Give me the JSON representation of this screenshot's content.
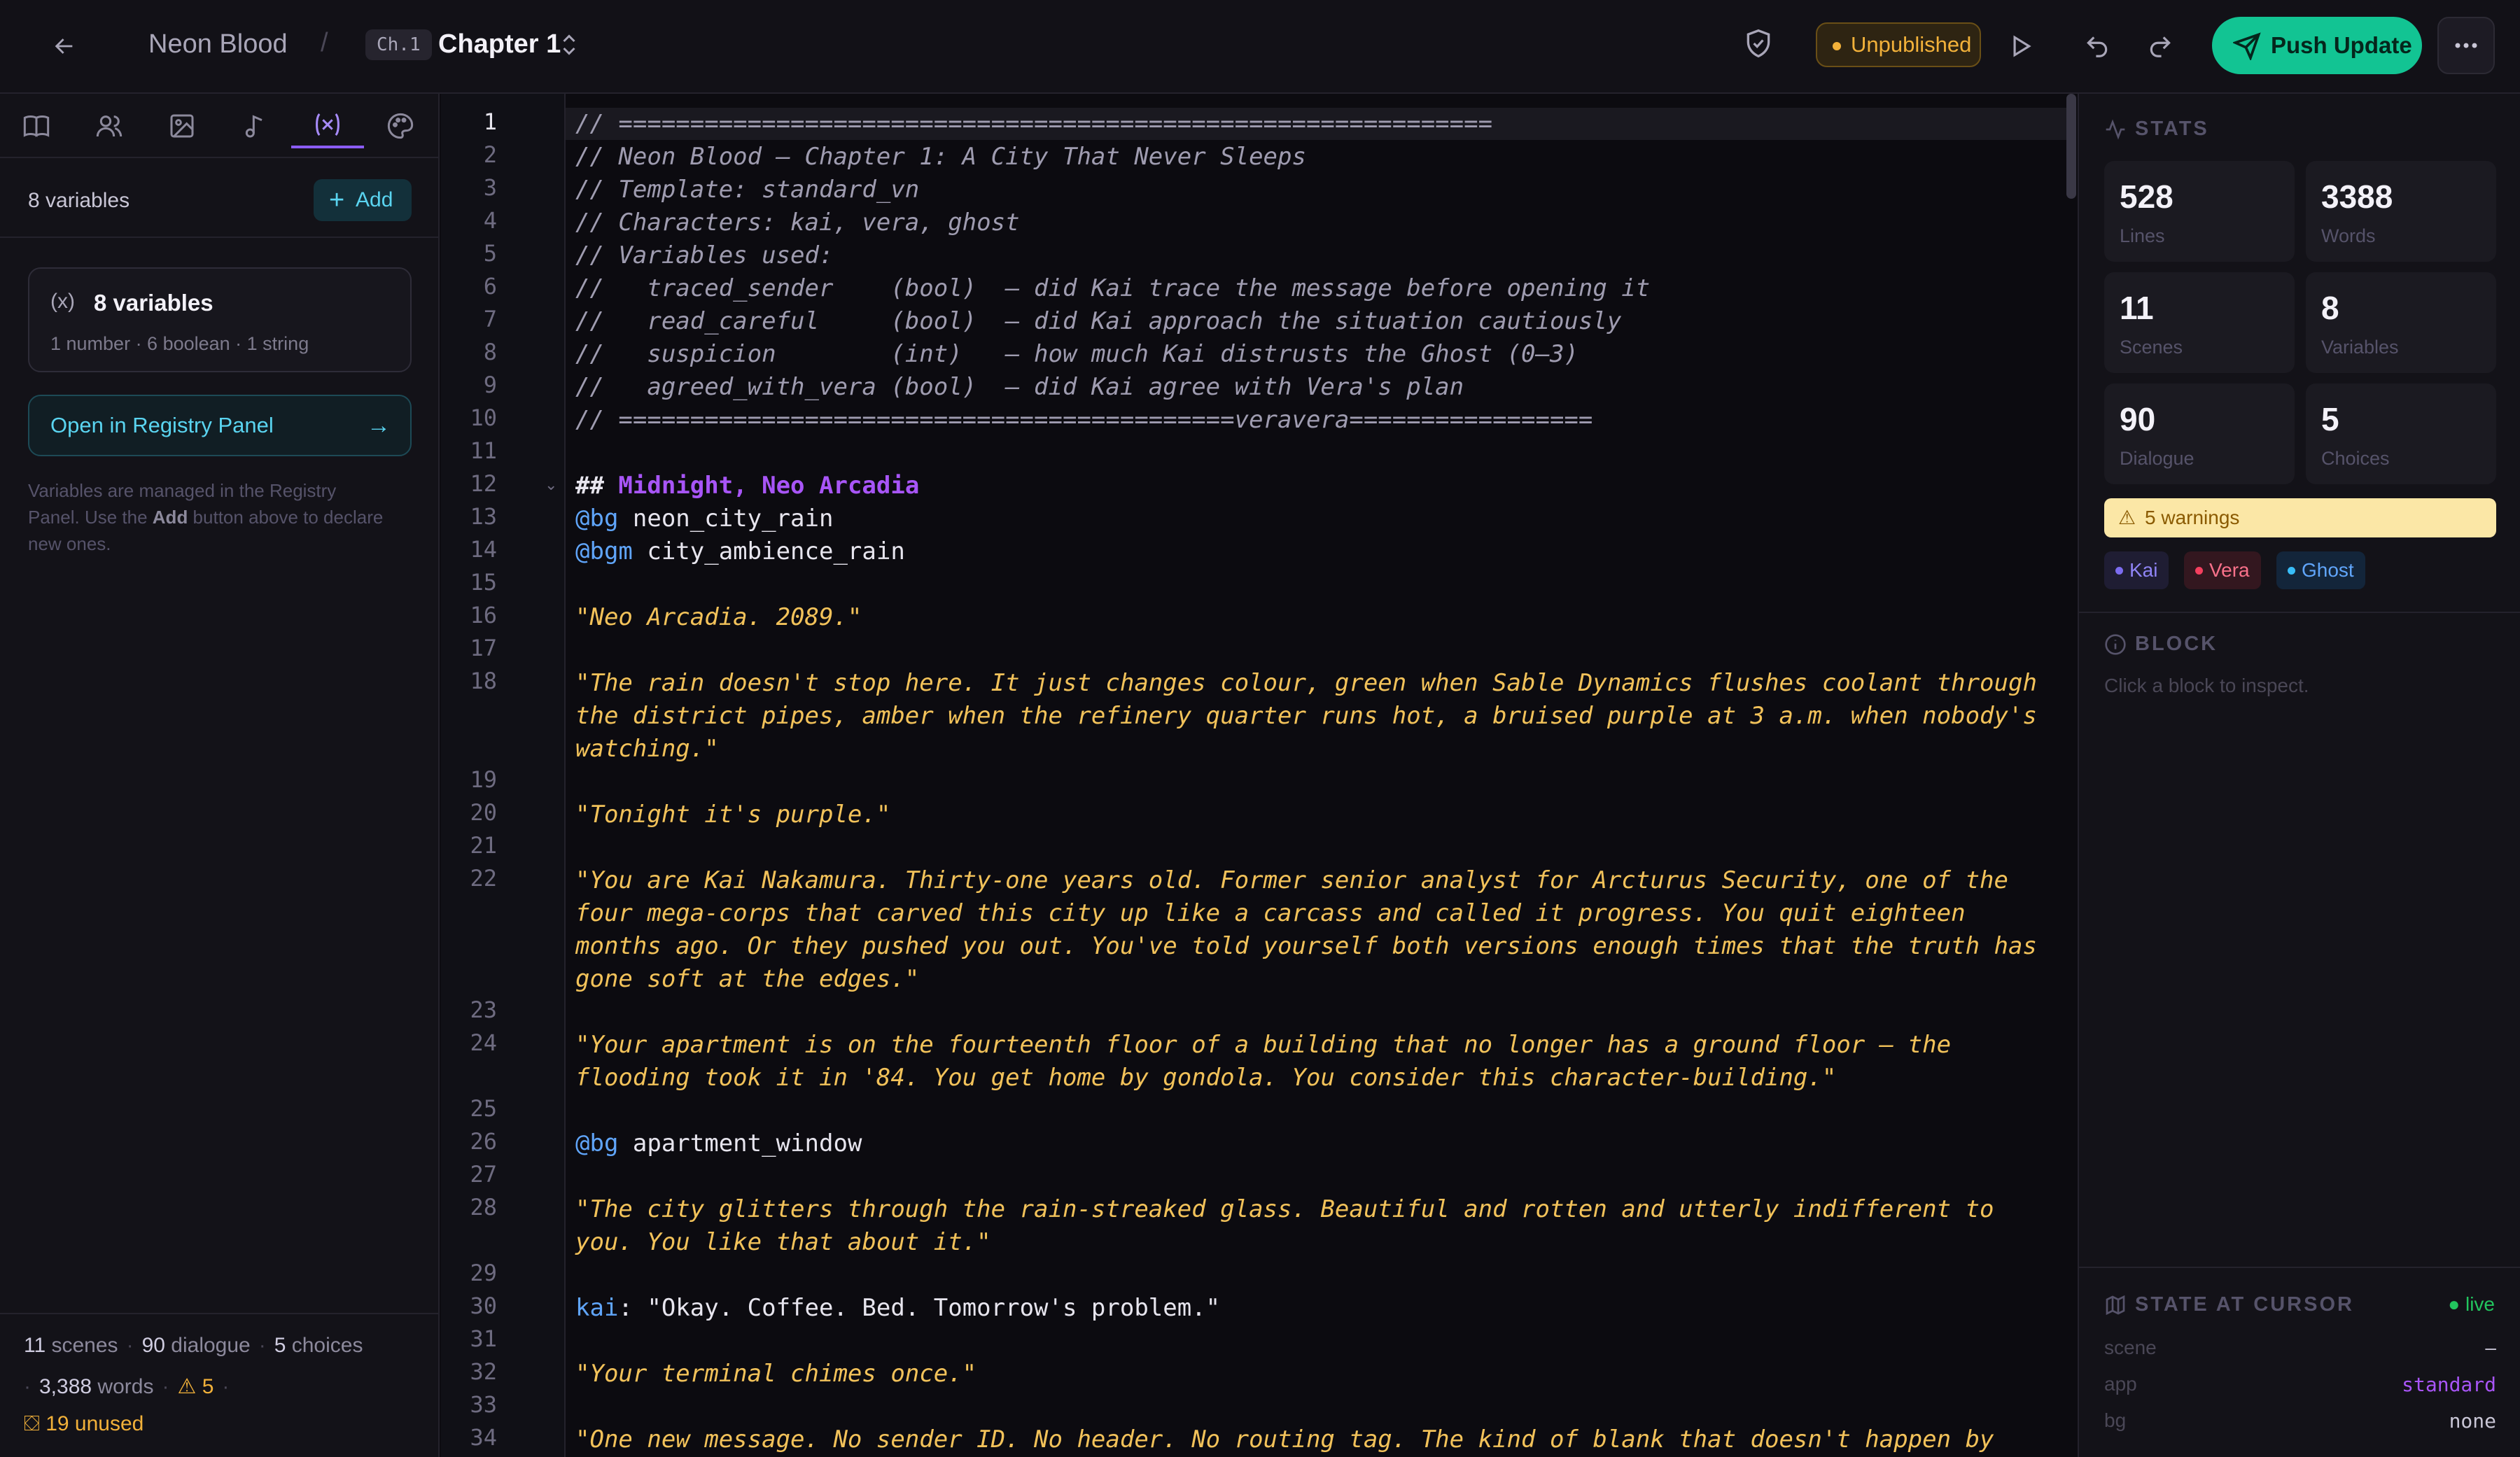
{
  "topbar": {
    "project_title": "Neon Blood",
    "separator": "/",
    "chapter_badge": "Ch.1",
    "chapter_title": "Chapter 1",
    "status": "Unpublished",
    "push_label": "Push Update"
  },
  "sidebar": {
    "tabs": [
      "book-icon",
      "characters-icon",
      "image-icon",
      "music-icon",
      "variables-icon",
      "palette-icon"
    ],
    "active_tab": "variables-icon",
    "var_count": "8 variables",
    "add_label": "Add",
    "card_title": "8 variables",
    "card_sub": "1 number · 6 boolean · 1 string",
    "registry_label": "Open in Registry Panel",
    "note_pre": "Variables are managed in the Registry Panel. Use the ",
    "note_bold": "Add",
    "note_post": " button above to declare new ones.",
    "footer": {
      "scenes_n": "11",
      "scenes_l": "scenes",
      "dialogue_n": "90",
      "dialogue_l": "dialogue",
      "choices_n": "5",
      "choices_l": "choices",
      "words_n": "3,388",
      "words_l": "words",
      "warnings_n": "5",
      "unused": "19 unused"
    }
  },
  "editor": {
    "line_numbers": [
      "1",
      "2",
      "3",
      "4",
      "5",
      "6",
      "7",
      "8",
      "9",
      "10",
      "11",
      "12",
      "13",
      "14",
      "15",
      "16",
      "17",
      "18",
      "19",
      "20",
      "21",
      "22",
      "23",
      "24",
      "25",
      "26",
      "27",
      "28",
      "29",
      "30",
      "31",
      "32",
      "33",
      "34"
    ],
    "lines": {
      "l1": "// =============================================================",
      "l2": "// Neon Blood — Chapter 1: A City That Never Sleeps",
      "l3": "// Template: standard_vn",
      "l4": "// Characters: kai, vera, ghost",
      "l5": "// Variables used:",
      "l6": "//   traced_sender    (bool)  — did Kai trace the message before opening it",
      "l7": "//   read_careful     (bool)  — did Kai approach the situation cautiously",
      "l8": "//   suspicion        (int)   — how much Kai distrusts the Ghost (0–3)",
      "l9": "//   agreed_with_vera (bool)  — did Kai agree with Vera's plan",
      "l10": "// ===========================================veravera=================",
      "l12_hash": "## ",
      "l12_text": "Midnight, Neo Arcadia",
      "l13_cmd": "@bg",
      "l13_arg": " neon_city_rain",
      "l14_cmd": "@bgm",
      "l14_arg": " city_ambience_rain",
      "l16": "\"Neo Arcadia. 2089.\"",
      "l18a": "\"The rain doesn't stop here. It just changes colour, green when Sable Dynamics flushes coolant through",
      "l18b": "the district pipes, amber when the refinery quarter runs hot, a bruised purple at 3 a.m. when nobody's",
      "l18c": "watching.\"",
      "l20": "\"Tonight it's purple.\"",
      "l22a": "\"You are Kai Nakamura. Thirty-one years old. Former senior analyst for Arcturus Security, one of the",
      "l22b": "four mega-corps that carved this city up like a carcass and called it progress. You quit eighteen",
      "l22c": "months ago. Or they pushed you out. You've told yourself both versions enough times that the truth has",
      "l22d": "gone soft at the edges.\"",
      "l24a": "\"Your apartment is on the fourteenth floor of a building that no longer has a ground floor — the",
      "l24b": "flooding took it in '84. You get home by gondola. You consider this character-building.\"",
      "l26_cmd": "@bg",
      "l26_arg": " apartment_window",
      "l28a": "\"The city glitters through the rain-streaked glass. Beautiful and rotten and utterly indifferent to",
      "l28b": "you. You like that about it.\"",
      "l30_spk": "kai",
      "l30_txt": ": \"Okay. Coffee. Bed. Tomorrow's problem.\"",
      "l32": "\"Your terminal chimes once.\"",
      "l34": "\"One new message. No sender ID. No header. No routing tag. The kind of blank that doesn't happen by"
    }
  },
  "right_panel": {
    "stats_title": "STATS",
    "stats": [
      {
        "value": "528",
        "label": "Lines"
      },
      {
        "value": "3388",
        "label": "Words"
      },
      {
        "value": "11",
        "label": "Scenes"
      },
      {
        "value": "8",
        "label": "Variables"
      },
      {
        "value": "90",
        "label": "Dialogue"
      },
      {
        "value": "5",
        "label": "Choices"
      }
    ],
    "warnings": "5 warnings",
    "characters": [
      {
        "name": "Kai",
        "color": "#7c6cf0",
        "bg": "#1f1d33",
        "text": "#8f84f5"
      },
      {
        "name": "Vera",
        "color": "#f43f5e",
        "bg": "#33171f",
        "text": "#f8718a"
      },
      {
        "name": "Ghost",
        "color": "#38bdf8",
        "bg": "#13253a",
        "text": "#60a5fa"
      }
    ],
    "block_title": "BLOCK",
    "block_hint": "Click a block to inspect.",
    "state_title": "STATE AT CURSOR",
    "live": "live",
    "state": [
      {
        "key": "scene",
        "value": "–"
      },
      {
        "key": "app",
        "value": "standard"
      },
      {
        "key": "bg",
        "value": "none"
      }
    ]
  },
  "colors": {
    "accent_push": "#12c493",
    "accent_purple": "#8b5cf6",
    "status_amber": "#f2b13a",
    "string_yellow": "#f2c25a",
    "command_blue": "#60a5fa"
  }
}
